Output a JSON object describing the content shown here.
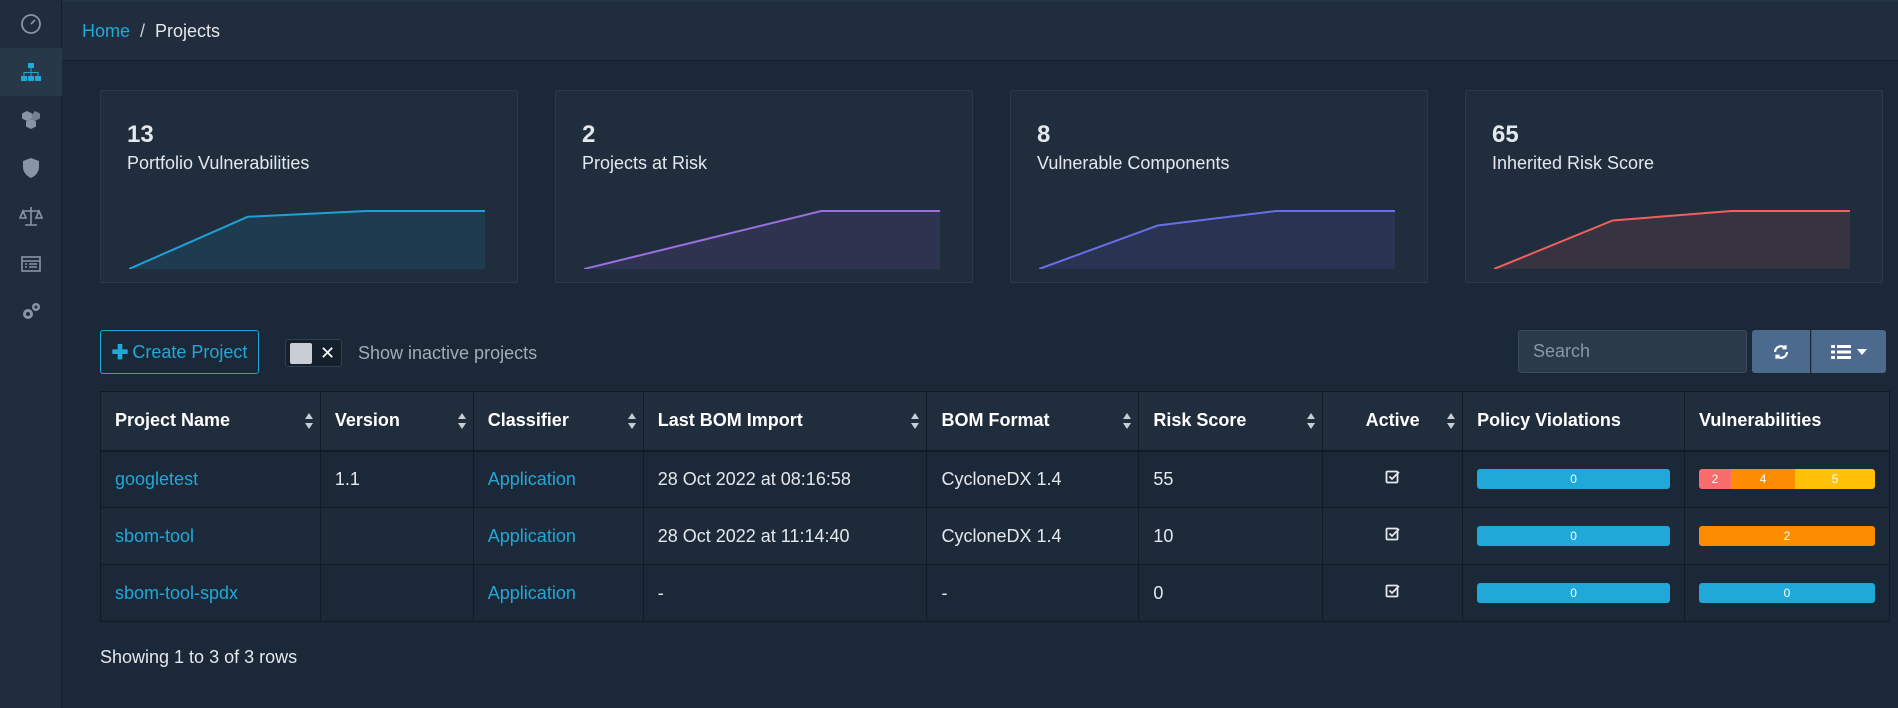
{
  "breadcrumb": {
    "home": "Home",
    "separator": "/",
    "current": "Projects"
  },
  "sidebar": {
    "items": [
      {
        "icon": "dashboard-icon"
      },
      {
        "icon": "projects-icon",
        "active": true
      },
      {
        "icon": "components-icon"
      },
      {
        "icon": "vulnerabilities-icon"
      },
      {
        "icon": "policy-icon"
      },
      {
        "icon": "notifications-icon"
      },
      {
        "icon": "settings-icon"
      }
    ]
  },
  "cards": [
    {
      "value": "13",
      "label": "Portfolio Vulnerabilities",
      "color": "#1da1d6",
      "trend": [
        0,
        9,
        10,
        10
      ]
    },
    {
      "value": "2",
      "label": "Projects at Risk",
      "color": "#9c6ee0",
      "trend": [
        0,
        1,
        2,
        2
      ]
    },
    {
      "value": "8",
      "label": "Vulnerable Components",
      "color": "#6a6ee8",
      "trend": [
        0,
        6,
        8,
        8
      ]
    },
    {
      "value": "65",
      "label": "Inherited Risk Score",
      "color": "#f0605f",
      "trend": [
        0,
        46,
        55,
        55
      ]
    }
  ],
  "toolbar": {
    "create_label": "Create Project",
    "toggle_x": "✕",
    "toggle_label": "Show inactive projects",
    "search_placeholder": "Search"
  },
  "table": {
    "headers": [
      "Project Name",
      "Version",
      "Classifier",
      "Last BOM Import",
      "BOM Format",
      "Risk Score",
      "Active",
      "Policy Violations",
      "Vulnerabilities"
    ],
    "rows": [
      {
        "name": "googletest",
        "version": "1.1",
        "classifier": "Application",
        "last_import": "28 Oct 2022 at 08:16:58",
        "bom_format": "CycloneDX 1.4",
        "risk_score": "55",
        "active": true,
        "policy_violations": "0",
        "vulns": [
          {
            "sev": "critical",
            "count": "2"
          },
          {
            "sev": "high",
            "count": "4"
          },
          {
            "sev": "medium",
            "count": "5"
          }
        ]
      },
      {
        "name": "sbom-tool",
        "version": "",
        "classifier": "Application",
        "last_import": "28 Oct 2022 at 11:14:40",
        "bom_format": "CycloneDX 1.4",
        "risk_score": "10",
        "active": true,
        "policy_violations": "0",
        "vulns": [
          {
            "sev": "high",
            "count": "2"
          }
        ]
      },
      {
        "name": "sbom-tool-spdx",
        "version": "",
        "classifier": "Application",
        "last_import": "-",
        "bom_format": "-",
        "risk_score": "0",
        "active": true,
        "policy_violations": "0",
        "vulns": [
          {
            "sev": "none",
            "count": "0"
          }
        ]
      }
    ]
  },
  "footer": {
    "showing": "Showing 1 to 3 of 3 rows"
  }
}
